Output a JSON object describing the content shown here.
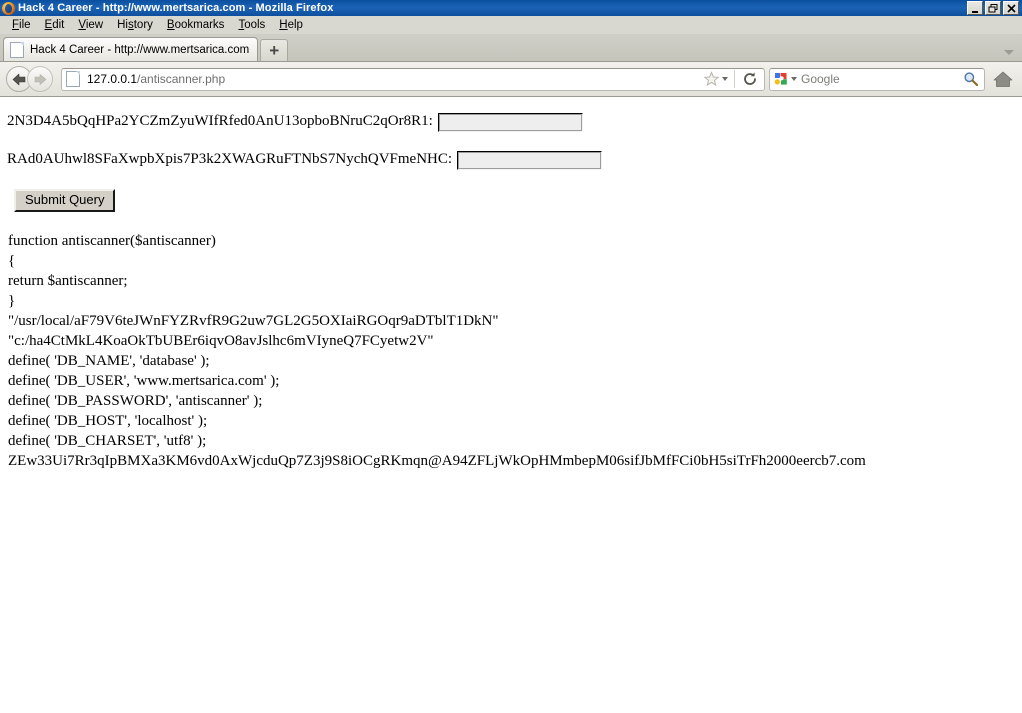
{
  "window": {
    "title": "Hack 4 Career - http://www.mertsarica.com - Mozilla Firefox",
    "app_icon": "firefox-icon",
    "minimize_label": "Minimize",
    "maximize_label": "Restore",
    "close_label": "Close"
  },
  "menubar": {
    "items": [
      {
        "label": "File",
        "accesskey": "F"
      },
      {
        "label": "Edit",
        "accesskey": "E"
      },
      {
        "label": "View",
        "accesskey": "V"
      },
      {
        "label": "History",
        "accesskey": "s"
      },
      {
        "label": "Bookmarks",
        "accesskey": "B"
      },
      {
        "label": "Tools",
        "accesskey": "T"
      },
      {
        "label": "Help",
        "accesskey": "H"
      }
    ]
  },
  "tabstrip": {
    "tabs": [
      {
        "label": "Hack 4 Career - http://www.mertsarica.com",
        "active": true
      }
    ],
    "new_tab_label": "+",
    "list_all_tabs_label": "List all tabs"
  },
  "navbar": {
    "back_label": "Back",
    "forward_label": "Forward",
    "url_host": "127.0.0.1",
    "url_path": "/antiscanner.php",
    "bookmark_label": "Bookmark this page",
    "reload_label": "Reload",
    "search_engine": "Google",
    "search_placeholder": "Google",
    "search_value": "",
    "home_label": "Home"
  },
  "page": {
    "field1": {
      "label": "2N3D4A5bQqHPa2YCZmZyuWIfRfed0AnU13opboBNruC2qOr8R1:",
      "value": "",
      "placeholder": ""
    },
    "field2": {
      "label": "RAd0AUhwl8SFaXwpbXpis7P3k2XWAGRuFTNbS7NychQVFmeNHC:",
      "value": "",
      "placeholder": ""
    },
    "submit_label": "Submit Query",
    "code_lines": [
      "function antiscanner($antiscanner)",
      "{",
      "return $antiscanner;",
      "}",
      "\"/usr/local/aF79V6teJWnFYZRvfR9G2uw7GL2G5OXIaiRGOqr9aDTblT1DkN\"",
      "\"c:/ha4CtMkL4KoaOkTbUBEr6iqvO8avJslhc6mVIyneQ7FCyetw2V\"",
      "define( 'DB_NAME', 'database' );",
      "define( 'DB_USER', 'www.mertsarica.com' );",
      "define( 'DB_PASSWORD', 'antiscanner' );",
      "define( 'DB_HOST', 'localhost' );",
      "define( 'DB_CHARSET', 'utf8' );",
      "ZEw33Ui7Rr3qIpBMXa3KM6vd0AxWjcduQp7Z3j9S8iOCgRKmqn@A94ZFLjWkOpHMmbepM06sifJbMfFCi0bH5siTrFh2000eercb7.com"
    ]
  },
  "colors": {
    "titlebar_blue": "#0d4f9e",
    "chrome_grey": "#d9d8d0",
    "page_white": "#ffffff"
  }
}
